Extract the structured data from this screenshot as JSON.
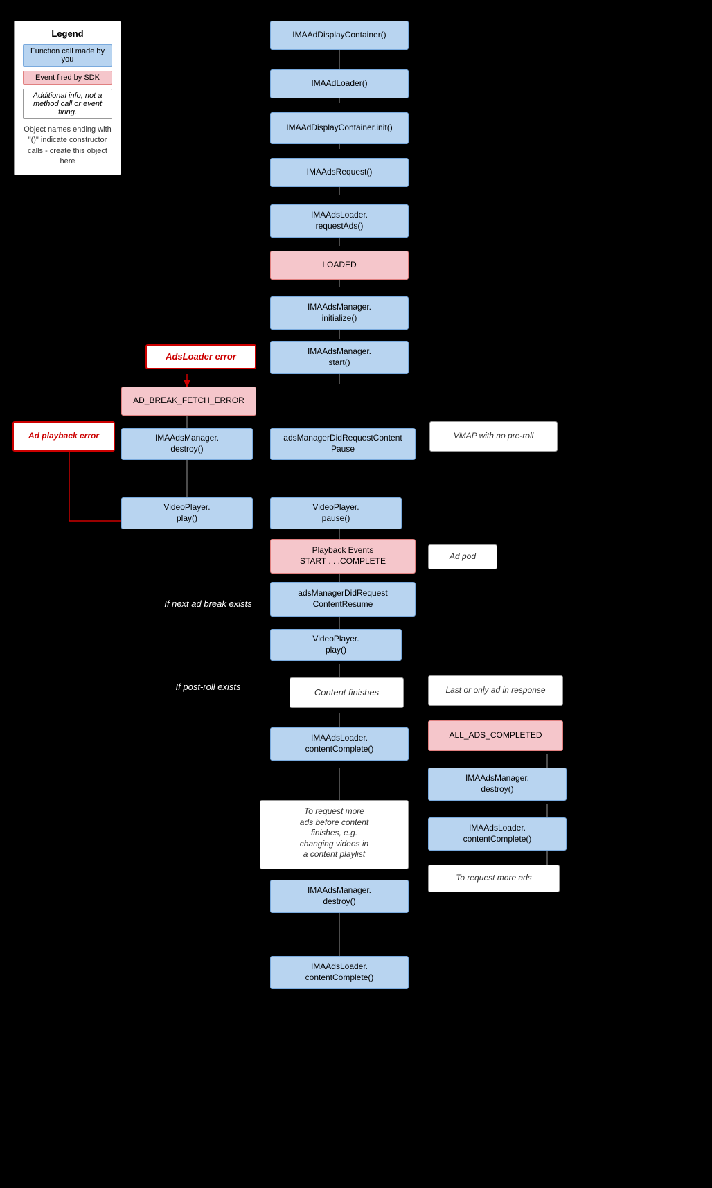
{
  "legend": {
    "title": "Legend",
    "item1": "Function call made by you",
    "item2": "Event fired by SDK",
    "item3": "Additional info, not a method call or event firing.",
    "note": "Object names ending with \"()\" indicate constructor calls - create this object here"
  },
  "boxes": {
    "imaAdDisplayContainer": "IMAAdDisplayContainer()",
    "imaAdsLoader": "IMAAdLoader()",
    "imaAdDisplayContainerInit": "IMAAdDisplayContainer.init()",
    "imaAdsRequest": "IMAAdsRequest()",
    "imaAdsLoaderRequestAds": "IMAAdsLoader.\nrequestAds()",
    "loaded": "LOADED",
    "imaAdsManagerInitialize": "IMAAdsManager.\ninitialize()",
    "imaAdsManagerStart": "IMAAdsManager.\nstart()",
    "adsLoaderError": "AdsLoader error",
    "adBreakFetchError": "AD_BREAK_FETCH_ERROR",
    "adPlaybackError": "Ad playback error",
    "imaAdsManagerDestroy1": "IMAAdsManager.\ndestroy()",
    "adsManagerDidRequestContentPause": "adsManagerDidRequestContent\nPause",
    "videoPlayerPlay1": "VideoPlayer.\nplay()",
    "videoPlayerPause": "VideoPlayer.\npause()",
    "playbackEvents": "Playback Events\nSTART . . .COMPLETE",
    "adPod": "Ad pod",
    "ifNextAdBreakExists": "If next ad break exists",
    "adsManagerDidRequestContentResume": "adsManagerDidRequest\nContentResume",
    "videoPlayerPlay2": "VideoPlayer.\nplay()",
    "ifPostRollExists": "If post-roll exists",
    "contentFinishes": "Content finishes",
    "lastOrOnlyAdInResponse": "Last or only ad in response",
    "allAdsCompleted": "ALL_ADS_COMPLETED",
    "imaAdsLoaderContentComplete1": "IMAAdsLoader.\ncontentComplete()",
    "imaAdsManagerDestroy2": "IMAAdsManager.\ndestroy()",
    "imaAdsLoaderContentComplete2": "IMAAdsLoader.\ncontentComplete()",
    "toRequestMoreAds": "To request more ads",
    "toRequestMoreAdsBefore": "To request more\nads before content\nfinishes, e.g.\nchanging videos in\na content playlist",
    "imaAdsManagerDestroy3": "IMAAdsManager.\ndestroy()",
    "imaAdsLoaderContentComplete3": "IMAAdsLoader.\ncontentComplete()",
    "vmapWithNoPreRoll": "VMAP with no pre-roll"
  }
}
